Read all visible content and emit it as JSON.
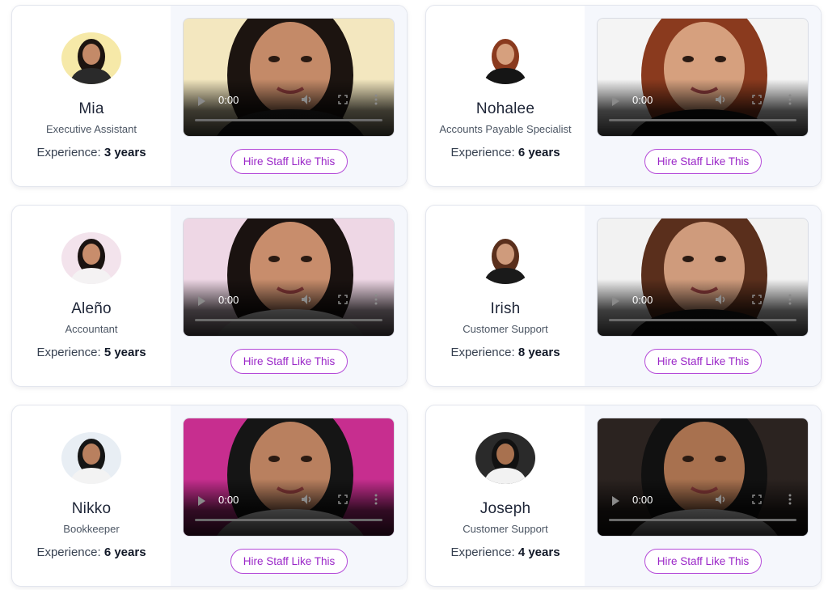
{
  "cards": [
    {
      "name": "Mia",
      "role": "Executive Assistant",
      "experience_label": "Experience:",
      "experience_value": "3 years",
      "video_time": "0:00",
      "hire_label": "Hire Staff Like This",
      "colors": {
        "avatar_bg": "#f6e9a8",
        "video_bg": "#f3e7bf",
        "hair": "#1c1410",
        "skin": "#c48a68",
        "shirt": "#2a2a2a"
      }
    },
    {
      "name": "Nohalee",
      "role": "Accounts Payable Specialist",
      "experience_label": "Experience:",
      "experience_value": "6 years",
      "video_time": "0:00",
      "hire_label": "Hire Staff Like This",
      "colors": {
        "avatar_bg": "#ffffff",
        "video_bg": "#f4f4f4",
        "hair": "#8a3a1e",
        "skin": "#d6a07e",
        "shirt": "#151515"
      }
    },
    {
      "name": "Aleño",
      "role": "Accountant",
      "experience_label": "Experience:",
      "experience_value": "5 years",
      "video_time": "0:00",
      "hire_label": "Hire Staff Like This",
      "colors": {
        "avatar_bg": "#f3e3ec",
        "video_bg": "#eed7e5",
        "hair": "#1a1210",
        "skin": "#c88d6c",
        "shirt": "#f4f2f3"
      }
    },
    {
      "name": "Irish",
      "role": "Customer Support",
      "experience_label": "Experience:",
      "experience_value": "8 years",
      "video_time": "0:00",
      "hire_label": "Hire Staff Like This",
      "colors": {
        "avatar_bg": "#ffffff",
        "video_bg": "#f2f2f2",
        "hair": "#5a2f1c",
        "skin": "#cf9b7c",
        "shirt": "#1a1a1a"
      }
    },
    {
      "name": "Nikko",
      "role": "Bookkeeper",
      "experience_label": "Experience:",
      "experience_value": "6 years",
      "video_time": "0:00",
      "hire_label": "Hire Staff Like This",
      "colors": {
        "avatar_bg": "#e8eef4",
        "video_bg": "#c72e8f",
        "hair": "#151515",
        "skin": "#b9805f",
        "shirt": "#f3f3f3"
      }
    },
    {
      "name": "Joseph",
      "role": "Customer Support",
      "experience_label": "Experience:",
      "experience_value": "4 years",
      "video_time": "0:00",
      "hire_label": "Hire Staff Like This",
      "colors": {
        "avatar_bg": "#2a2a2a",
        "video_bg": "#2b2320",
        "hair": "#111111",
        "skin": "#a8714f",
        "shirt": "#f2f2f2"
      }
    }
  ],
  "theme": {
    "accent": "#9b27c8",
    "accent_border": "#b44ad8",
    "panel_bg": "#f5f7fc"
  }
}
